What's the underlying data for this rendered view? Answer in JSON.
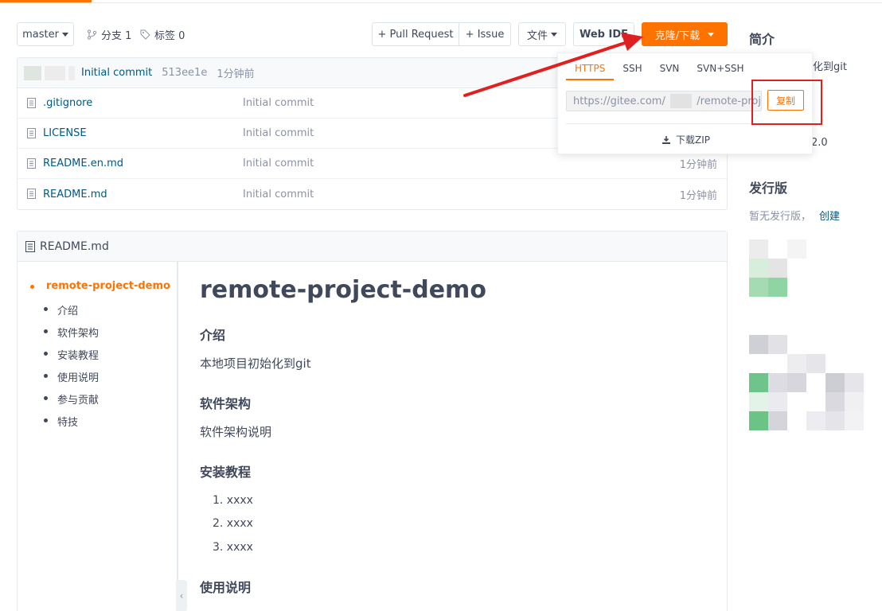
{
  "toolbar": {
    "branch": "master",
    "branches": "分支 1",
    "tags": "标签 0",
    "pull_request": "+ Pull Request",
    "issue": "+ Issue",
    "files": "文件",
    "web_ide": "Web IDE",
    "clone": "克隆/下载",
    "clone_color": "#fe7300"
  },
  "commit": {
    "message": "Initial commit",
    "hash": "513ee1e",
    "time": "1分钟前"
  },
  "files": [
    {
      "name": ".gitignore",
      "message": "Initial commit",
      "time": ""
    },
    {
      "name": "LICENSE",
      "message": "Initial commit",
      "time": ""
    },
    {
      "name": "README.en.md",
      "message": "Initial commit",
      "time": "1分钟前"
    },
    {
      "name": "README.md",
      "message": "Initial commit",
      "time": "1分钟前"
    }
  ],
  "readme": {
    "title": "README.md",
    "toc": [
      "remote-project-demo",
      "介绍",
      "软件架构",
      "安装教程",
      "使用说明",
      "参与贡献",
      "特技"
    ],
    "h1": "remote-project-demo",
    "sec_intro": "介绍",
    "intro_text": "本地项目初始化到git",
    "sec_arch": "软件架构",
    "arch_text": "软件架构说明",
    "sec_install": "安装教程",
    "install_steps": [
      "1. xxxx",
      "2. xxxx",
      "3. xxxx"
    ],
    "sec_usage": "使用说明"
  },
  "sidebar": {
    "intro_title": "简介",
    "intro_partial": "化到git",
    "license_partial": "2.0",
    "release_title": "发行版",
    "no_release": "暂无发行版，",
    "create_link": "创建"
  },
  "clone_dropdown": {
    "tabs": [
      "HTTPS",
      "SSH",
      "SVN",
      "SVN+SSH"
    ],
    "active_tab": "HTTPS",
    "url_prefix": "https://gitee.com/",
    "url_suffix": "/remote-proj",
    "copy": "复制",
    "download_zip": "下载ZIP"
  },
  "colors": {
    "accent": "#fe7300",
    "link": "#005980",
    "annotation": "#e02020"
  }
}
